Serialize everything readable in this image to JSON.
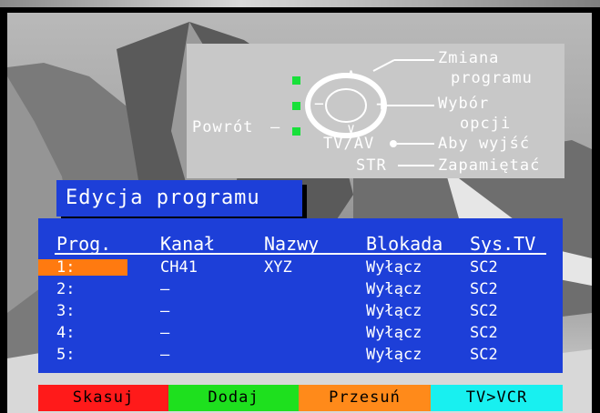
{
  "help": {
    "prog_label": "Zmiana",
    "prog_label2": "programu",
    "opt_label": "Wybór",
    "opt_label2": "opcji",
    "powrot": "Powrót",
    "tvav": "TV/AV",
    "str": "STR",
    "exit_label": "Aby wyjść",
    "save_label": "Zapamiętać",
    "up_symbol": "∧",
    "down_symbol": "∨",
    "minus_symbol": "−",
    "plus_symbol": "+"
  },
  "title": "Edycja programu",
  "table": {
    "headers": [
      "Prog.",
      "Kanał",
      "Nazwy",
      "Blokada",
      "Sys.TV"
    ],
    "rows": [
      {
        "prog": "1:",
        "kanal": "CH41",
        "nazwy": "XYZ",
        "blokada": "Wyłącz",
        "sys": "SC2"
      },
      {
        "prog": "2:",
        "kanal": "–",
        "nazwy": "",
        "blokada": "Wyłącz",
        "sys": "SC2"
      },
      {
        "prog": "3:",
        "kanal": "–",
        "nazwy": "",
        "blokada": "Wyłącz",
        "sys": "SC2"
      },
      {
        "prog": "4:",
        "kanal": "–",
        "nazwy": "",
        "blokada": "Wyłącz",
        "sys": "SC2"
      },
      {
        "prog": "5:",
        "kanal": "–",
        "nazwy": "",
        "blokada": "Wyłącz",
        "sys": "SC2"
      }
    ]
  },
  "buttons": [
    {
      "label": "Skasuj",
      "color": "#ff1a1a"
    },
    {
      "label": "Dodaj",
      "color": "#1ee01e"
    },
    {
      "label": "Przesuń",
      "color": "#ff8a1a"
    },
    {
      "label": "TV>VCR",
      "color": "#18f0f0"
    }
  ],
  "colors": {
    "panel": "#1d3fd8",
    "selection": "#ff7a10",
    "indicator": "#18e03a"
  }
}
